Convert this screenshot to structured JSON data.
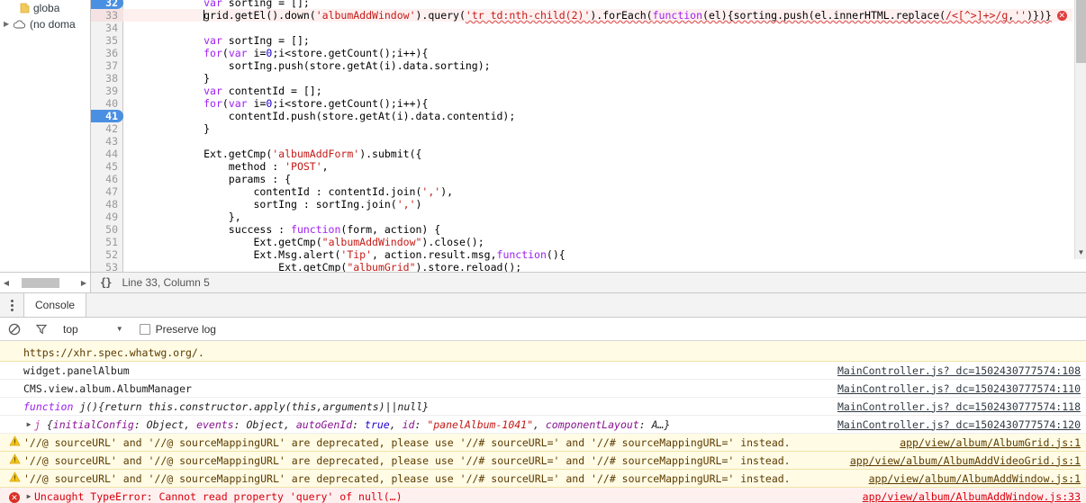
{
  "navigator": {
    "items": [
      {
        "icon": "folder-icon",
        "label": "globa",
        "expander": ""
      },
      {
        "icon": "cloud-icon",
        "label": "(no doma",
        "expander": "▶"
      }
    ]
  },
  "editor": {
    "scrollbar": {
      "vertical_present": true,
      "horizontal_present": true
    },
    "lines": [
      {
        "num": "32",
        "selected": true,
        "error": false,
        "partial": true,
        "tokens": [
          {
            "t": "            ",
            "c": "s-plain"
          },
          {
            "t": "var",
            "c": "s-kw"
          },
          {
            "t": " sorting = [];",
            "c": "s-plain"
          }
        ]
      },
      {
        "num": "33",
        "selected": false,
        "error": true,
        "caret": true,
        "tokens": [
          {
            "t": "            grid.getEl().down(",
            "c": "s-plain"
          },
          {
            "t": "'albumAddWindow'",
            "c": "s-str"
          },
          {
            "t": ").query(",
            "c": "s-plain"
          },
          {
            "t": "'tr td:nth-child(2)'",
            "c": "s-str squiggle"
          },
          {
            "t": ").forEach(",
            "c": "s-plain squiggle"
          },
          {
            "t": "function",
            "c": "s-kw squiggle"
          },
          {
            "t": "(el){sorting.push(el.innerHTML.replace(",
            "c": "s-plain squiggle"
          },
          {
            "t": "/<[^>]+>/g",
            "c": "s-regex squiggle"
          },
          {
            "t": ",",
            "c": "s-plain squiggle"
          },
          {
            "t": "''",
            "c": "s-str squiggle"
          },
          {
            "t": ")})}",
            "c": "s-plain squiggle"
          }
        ],
        "badge": "✕"
      },
      {
        "num": "34",
        "tokens": [
          {
            "t": "",
            "c": "s-plain"
          }
        ]
      },
      {
        "num": "35",
        "tokens": [
          {
            "t": "            ",
            "c": "s-plain"
          },
          {
            "t": "var",
            "c": "s-kw"
          },
          {
            "t": " sortIng = [];",
            "c": "s-plain"
          }
        ]
      },
      {
        "num": "36",
        "tokens": [
          {
            "t": "            ",
            "c": "s-plain"
          },
          {
            "t": "for",
            "c": "s-kw"
          },
          {
            "t": "(",
            "c": "s-plain"
          },
          {
            "t": "var",
            "c": "s-kw"
          },
          {
            "t": " i=",
            "c": "s-plain"
          },
          {
            "t": "0",
            "c": "s-num"
          },
          {
            "t": ";i<store.getCount();i++){",
            "c": "s-plain"
          }
        ]
      },
      {
        "num": "37",
        "tokens": [
          {
            "t": "                sortIng.push(store.getAt(i).data.sorting);",
            "c": "s-plain"
          }
        ]
      },
      {
        "num": "38",
        "tokens": [
          {
            "t": "            }",
            "c": "s-plain"
          }
        ]
      },
      {
        "num": "39",
        "tokens": [
          {
            "t": "            ",
            "c": "s-plain"
          },
          {
            "t": "var",
            "c": "s-kw"
          },
          {
            "t": " contentId = [];",
            "c": "s-plain"
          }
        ]
      },
      {
        "num": "40",
        "tokens": [
          {
            "t": "            ",
            "c": "s-plain"
          },
          {
            "t": "for",
            "c": "s-kw"
          },
          {
            "t": "(",
            "c": "s-plain"
          },
          {
            "t": "var",
            "c": "s-kw"
          },
          {
            "t": " i=",
            "c": "s-plain"
          },
          {
            "t": "0",
            "c": "s-num"
          },
          {
            "t": ";i<store.getCount();i++){",
            "c": "s-plain"
          }
        ]
      },
      {
        "num": "41",
        "selected": true,
        "tokens": [
          {
            "t": "                contentId.push(store.getAt(i).data.contentid);",
            "c": "s-plain"
          }
        ]
      },
      {
        "num": "42",
        "tokens": [
          {
            "t": "            }",
            "c": "s-plain"
          }
        ]
      },
      {
        "num": "43",
        "tokens": [
          {
            "t": "",
            "c": "s-plain"
          }
        ]
      },
      {
        "num": "44",
        "tokens": [
          {
            "t": "            Ext.getCmp(",
            "c": "s-plain"
          },
          {
            "t": "'albumAddForm'",
            "c": "s-str"
          },
          {
            "t": ").submit({",
            "c": "s-plain"
          }
        ]
      },
      {
        "num": "45",
        "tokens": [
          {
            "t": "                method : ",
            "c": "s-plain"
          },
          {
            "t": "'POST'",
            "c": "s-str"
          },
          {
            "t": ",",
            "c": "s-plain"
          }
        ]
      },
      {
        "num": "46",
        "tokens": [
          {
            "t": "                params : {",
            "c": "s-plain"
          }
        ]
      },
      {
        "num": "47",
        "tokens": [
          {
            "t": "                    contentId : contentId.join(",
            "c": "s-plain"
          },
          {
            "t": "','",
            "c": "s-str"
          },
          {
            "t": "),",
            "c": "s-plain"
          }
        ]
      },
      {
        "num": "48",
        "tokens": [
          {
            "t": "                    sortIng : sortIng.join(",
            "c": "s-plain"
          },
          {
            "t": "','",
            "c": "s-str"
          },
          {
            "t": ")",
            "c": "s-plain"
          }
        ]
      },
      {
        "num": "49",
        "tokens": [
          {
            "t": "                },",
            "c": "s-plain"
          }
        ]
      },
      {
        "num": "50",
        "tokens": [
          {
            "t": "                success : ",
            "c": "s-plain"
          },
          {
            "t": "function",
            "c": "s-kw"
          },
          {
            "t": "(form, action) {",
            "c": "s-plain"
          }
        ]
      },
      {
        "num": "51",
        "tokens": [
          {
            "t": "                    Ext.getCmp(",
            "c": "s-plain"
          },
          {
            "t": "\"albumAddWindow\"",
            "c": "s-str"
          },
          {
            "t": ").close();",
            "c": "s-plain"
          }
        ]
      },
      {
        "num": "52",
        "tokens": [
          {
            "t": "                    Ext.Msg.alert(",
            "c": "s-plain"
          },
          {
            "t": "'Tip'",
            "c": "s-str"
          },
          {
            "t": ", action.result.msg,",
            "c": "s-plain"
          },
          {
            "t": "function",
            "c": "s-kw"
          },
          {
            "t": "(){",
            "c": "s-plain"
          }
        ]
      },
      {
        "num": "53",
        "tokens": [
          {
            "t": "                        Ext.getCmp(",
            "c": "s-plain"
          },
          {
            "t": "\"albumGrid\"",
            "c": "s-str"
          },
          {
            "t": ").store.reload();",
            "c": "s-plain"
          }
        ]
      }
    ]
  },
  "statusbar": {
    "pretty_print_icon": "{}",
    "position": "Line 33, Column 5"
  },
  "drawer": {
    "menu_icon": "kebab-menu-icon",
    "tabs": [
      {
        "label": "Console",
        "active": true
      }
    ],
    "toolbar": {
      "clear_icon": "clear-console-icon",
      "filter_icon": "filter-icon",
      "context": "top",
      "context_caret": "▼",
      "preserve_log_label": "Preserve log",
      "preserve_log_checked": false
    },
    "rows": [
      {
        "level": "warning",
        "partial": true,
        "icon": "",
        "text": "https://xhr.spec.whatwg.org/.",
        "link": ""
      },
      {
        "level": "log",
        "icon": "",
        "text": "widget.panelAlbum",
        "link": "MainController.js? dc=1502430777574:108"
      },
      {
        "level": "log",
        "icon": "",
        "text": "CMS.view.album.AlbumManager",
        "link": "MainController.js? dc=1502430777574:110"
      },
      {
        "level": "log",
        "icon": "",
        "rich": [
          {
            "t": "function",
            "c": "m-kw"
          },
          {
            "t": " j(){return this.constructor.apply(this,arguments)||null}",
            "c": "m-plain"
          }
        ],
        "text": "function j(){return this.constructor.apply(this,arguments)||null}",
        "link": "MainController.js? dc=1502430777574:118"
      },
      {
        "level": "log",
        "disclosure": "▶",
        "rich": [
          {
            "t": "j ",
            "c": "m-name"
          },
          {
            "t": "{",
            "c": "m-plain"
          },
          {
            "t": "initialConfig",
            "c": "m-prop"
          },
          {
            "t": ": Object, ",
            "c": "m-plain"
          },
          {
            "t": "events",
            "c": "m-prop"
          },
          {
            "t": ": Object, ",
            "c": "m-plain"
          },
          {
            "t": "autoGenId",
            "c": "m-prop"
          },
          {
            "t": ": ",
            "c": "m-plain"
          },
          {
            "t": "true",
            "c": "m-val"
          },
          {
            "t": ", ",
            "c": "m-plain"
          },
          {
            "t": "id",
            "c": "m-prop"
          },
          {
            "t": ": ",
            "c": "m-plain"
          },
          {
            "t": "\"panelAlbum-1041\"",
            "c": "m-str"
          },
          {
            "t": ", ",
            "c": "m-plain"
          },
          {
            "t": "componentLayout",
            "c": "m-prop"
          },
          {
            "t": ": A…}",
            "c": "m-plain"
          }
        ],
        "text": "j {initialConfig: Object, events: Object, autoGenId: true, id: \"panelAlbum-1041\", componentLayout: A…}",
        "link": "MainController.js? dc=1502430777574:120"
      },
      {
        "level": "warning",
        "icon": "warning-icon",
        "text": "'//@ sourceURL' and '//@ sourceMappingURL' are deprecated, please use '//# sourceURL=' and '//# sourceMappingURL=' instead.",
        "link": "app/view/album/AlbumGrid.js:1"
      },
      {
        "level": "warning",
        "icon": "warning-icon",
        "text": "'//@ sourceURL' and '//@ sourceMappingURL' are deprecated, please use '//# sourceURL=' and '//# sourceMappingURL=' instead.",
        "link": "app/view/album/AlbumAddVideoGrid.js:1"
      },
      {
        "level": "warning",
        "icon": "warning-icon",
        "text": "'//@ sourceURL' and '//@ sourceMappingURL' are deprecated, please use '//# sourceURL=' and '//# sourceMappingURL=' instead.",
        "link": "app/view/album/AlbumAddWindow.js:1"
      },
      {
        "level": "error",
        "icon": "error-icon",
        "disclosure": "▶",
        "text": "Uncaught TypeError: Cannot read property 'query' of null(…)",
        "link": "app/view/album/AlbumAddWindow.js:33"
      }
    ]
  },
  "colors": {
    "warning_bg": "#fffbe5",
    "error_bg": "#fff0f0",
    "selection_blue": "#4a90e2",
    "string_red": "#c41a16",
    "keyword_purple": "#a020f0",
    "error_red": "#d8000c"
  }
}
